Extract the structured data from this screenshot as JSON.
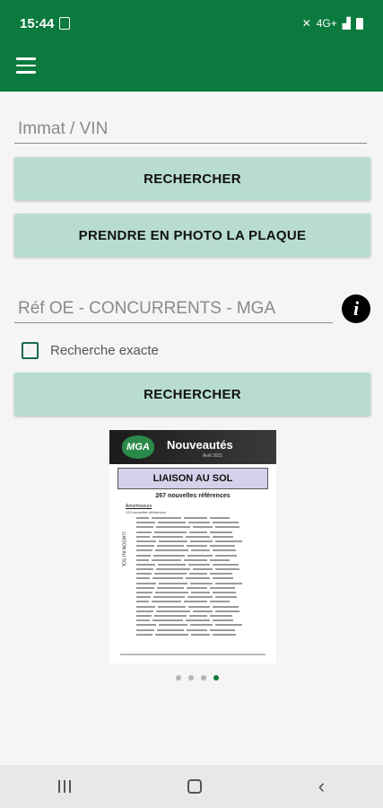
{
  "status_bar": {
    "time": "15:44",
    "network_label": "4G+"
  },
  "colors": {
    "app_bar": "#0b7a3e",
    "button_bg": "#b8ddd0",
    "dot_active": "#0b7a3e"
  },
  "toolbar": {
    "menu_icon": "hamburger-menu-icon"
  },
  "vehicle_search": {
    "placeholder": "Immat / VIN",
    "value": "",
    "search_button": "RECHERCHER",
    "photo_button": "PRENDRE EN PHOTO LA PLAQUE"
  },
  "reference_search": {
    "placeholder": "Réf OE - CONCURRENTS - MGA",
    "value": "",
    "info_icon": "info-icon",
    "info_glyph": "i",
    "exact_label": "Recherche exacte",
    "exact_checked": false,
    "search_button": "RECHERCHER"
  },
  "carousel": {
    "logo_text": "MGA",
    "brand_title": "Nouveautés",
    "brand_subtitle": "Avril 2021",
    "section_title": "LIAISON AU SOL",
    "subtitle": "267 nouvelles références",
    "category": "Amortisseurs",
    "category_sub": "133 nouvelles références",
    "vertical_label": "LIAISON AU SOL",
    "slide_count": 4,
    "active_slide": 3
  },
  "nav_bar": {
    "recent": "recent-apps-icon",
    "home": "home-icon",
    "back": "back-icon",
    "back_glyph": "‹"
  }
}
